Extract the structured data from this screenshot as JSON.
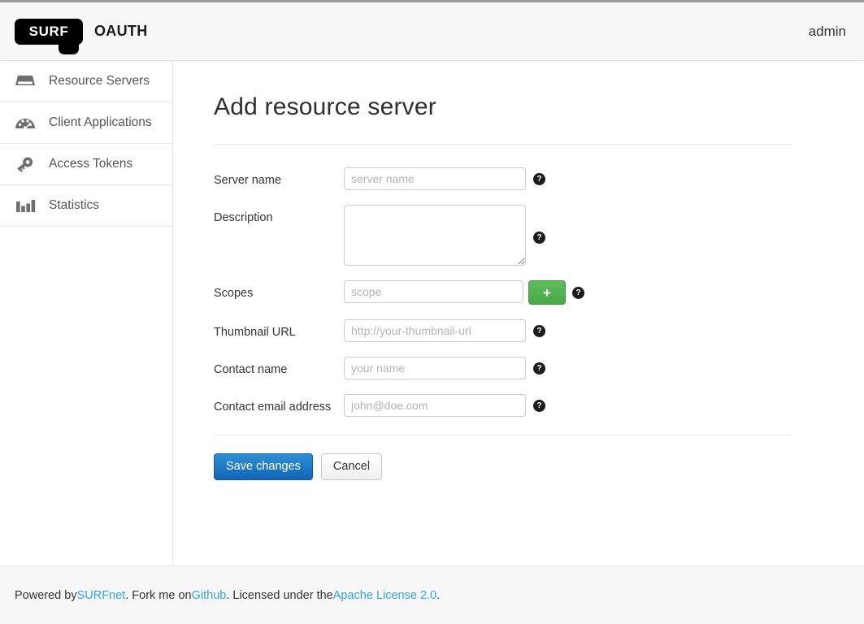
{
  "header": {
    "logo_text": "SURF",
    "logo_suffix": "OAUTH",
    "user": "admin"
  },
  "sidebar": {
    "items": [
      {
        "label": "Resource Servers",
        "icon": "server-icon"
      },
      {
        "label": "Client Applications",
        "icon": "dashboard-gauge-icon"
      },
      {
        "label": "Access Tokens",
        "icon": "key-icon"
      },
      {
        "label": "Statistics",
        "icon": "bar-chart-icon"
      }
    ]
  },
  "main": {
    "title": "Add resource server",
    "fields": [
      {
        "label": "Server name",
        "placeholder": "server name",
        "value": "",
        "help": "?"
      },
      {
        "label": "Description",
        "placeholder": "",
        "value": "",
        "help": "?"
      },
      {
        "label": "Scopes",
        "placeholder": "scope",
        "value": "",
        "help": "?",
        "add_label": "+"
      },
      {
        "label": "Thumbnail URL",
        "placeholder": "http://your-thumbnail-url",
        "value": "",
        "help": "?"
      },
      {
        "label": "Contact name",
        "placeholder": "your name",
        "value": "",
        "help": "?"
      },
      {
        "label": "Contact email address",
        "placeholder": "john@doe.com",
        "value": "",
        "help": "?"
      }
    ],
    "save_label": "Save changes",
    "cancel_label": "Cancel"
  },
  "footer": {
    "prefix": "Powered by ",
    "link1": "SURFnet",
    "mid1": ". Fork me on ",
    "link2": "Github",
    "mid2": ". Licensed under the ",
    "link3": "Apache License 2.0",
    "suffix": "."
  },
  "colors": {
    "accent_blue": "#2fa4e7",
    "primary_button": "#1164b4",
    "add_button_green": "#49a948",
    "help_icon": "#1c1c1c"
  }
}
